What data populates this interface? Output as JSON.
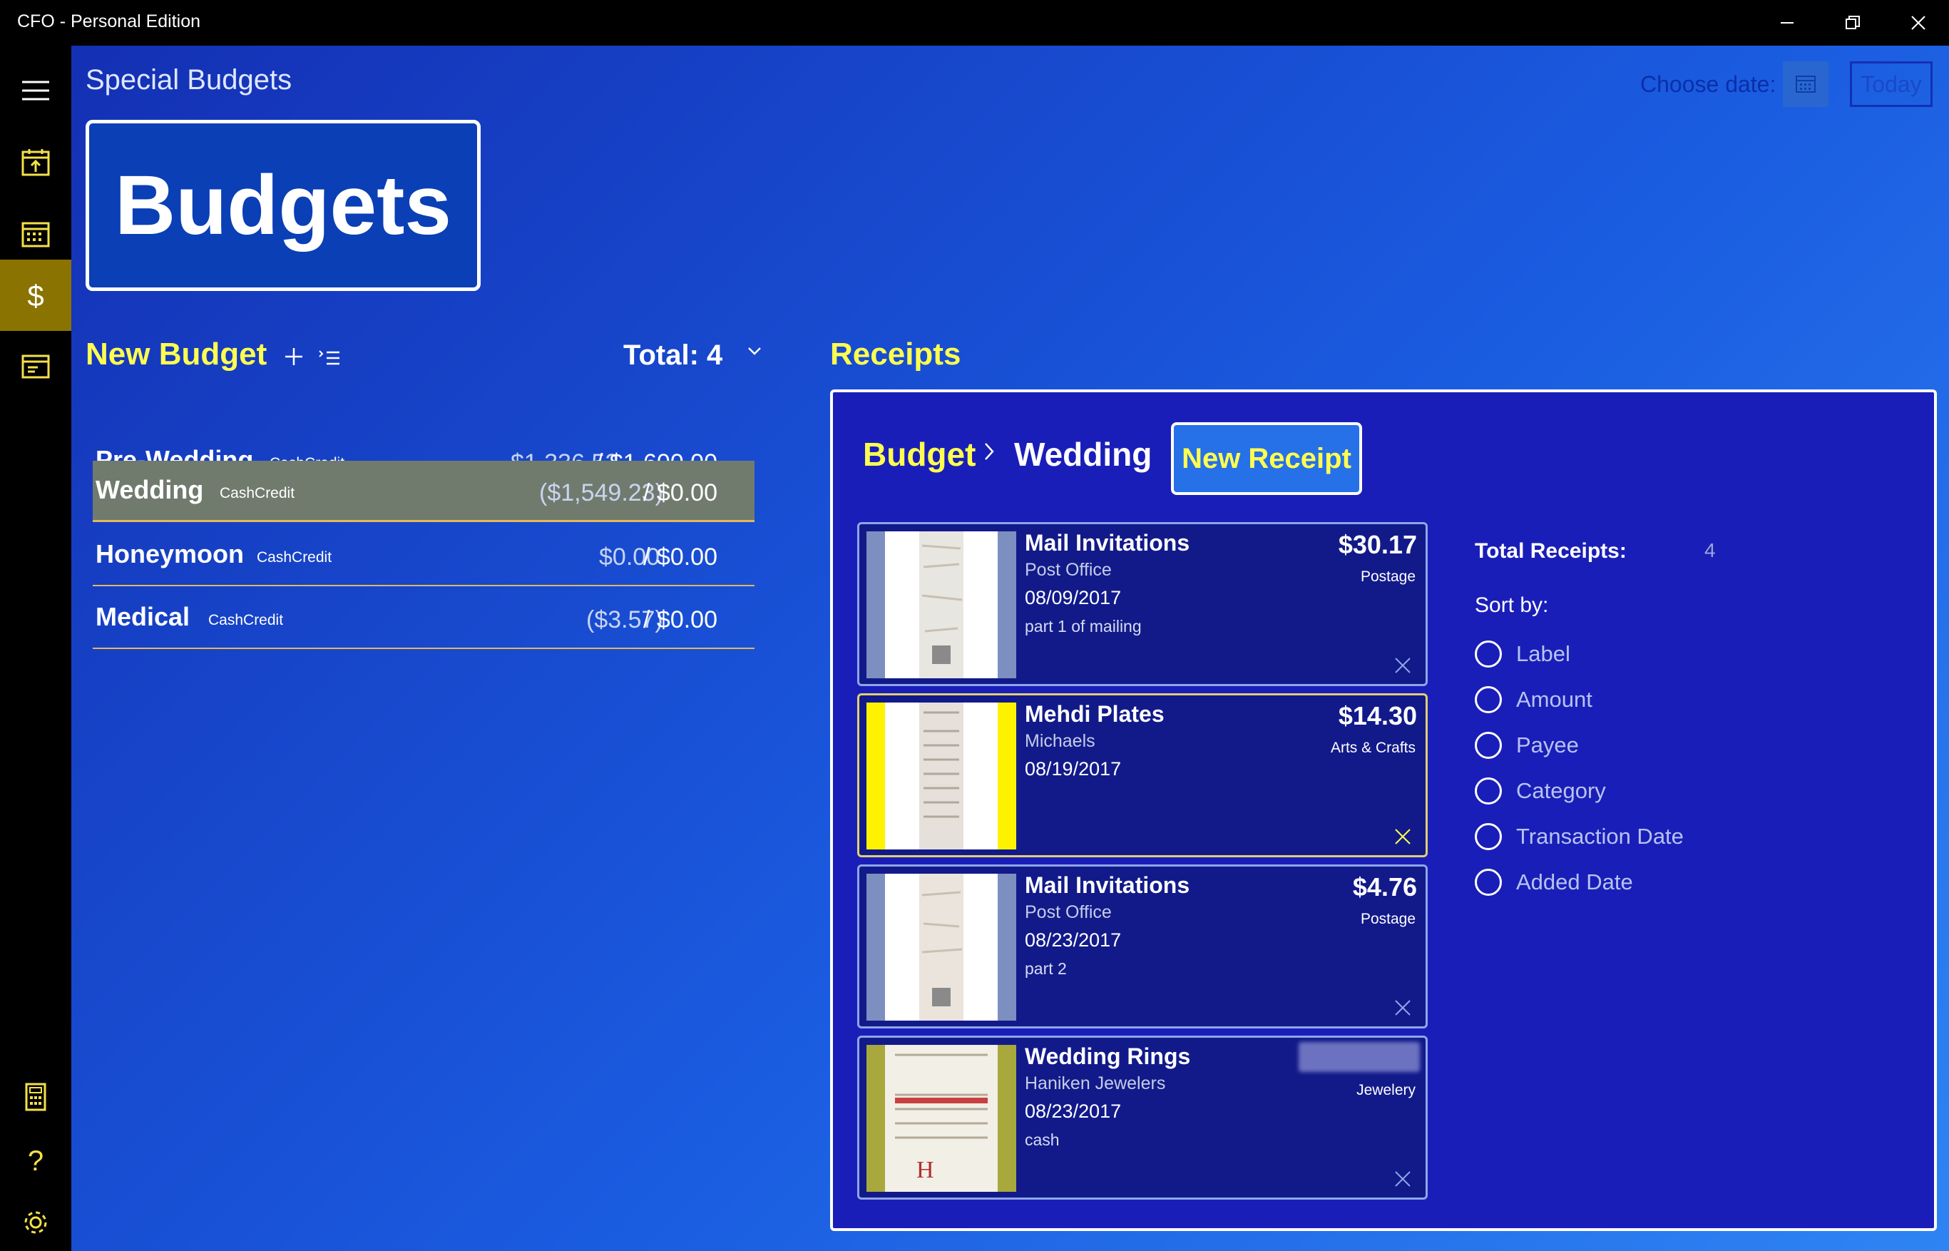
{
  "window": {
    "title": "CFO - Personal Edition"
  },
  "sidebar": {
    "items": [
      {
        "icon": "menu-icon"
      },
      {
        "icon": "calendar-upload-icon"
      },
      {
        "icon": "calendar-icon"
      },
      {
        "icon": "dollar-icon",
        "active": true
      },
      {
        "icon": "archive-icon"
      },
      {
        "icon": "calculator-icon"
      },
      {
        "icon": "help-icon"
      },
      {
        "icon": "gear-icon"
      }
    ]
  },
  "header": {
    "page_title": "Special Budgets",
    "choose_date_label": "Choose date:",
    "today_label": "Today",
    "logo_text": "Budgets"
  },
  "budgets": {
    "new_budget_label": "New Budget",
    "total_label": "Total: 4",
    "items": [
      {
        "name": "Pre-Wedding",
        "type": "CashCredit",
        "spent": "$1,336.52",
        "amount": "/ $1,600.00",
        "selected": false
      },
      {
        "name": "Wedding",
        "type": "CashCredit",
        "spent": "($1,549.23)",
        "amount": "/ $0.00",
        "selected": true
      },
      {
        "name": "Honeymoon",
        "type": "CashCredit",
        "spent": "$0.00",
        "amount": "/ $0.00",
        "selected": false
      },
      {
        "name": "Medical",
        "type": "CashCredit",
        "spent": "($3.57)",
        "amount": "/ $0.00",
        "selected": false
      }
    ]
  },
  "receipts": {
    "heading": "Receipts",
    "breadcrumb_root": "Budget",
    "breadcrumb_current": "Wedding",
    "new_receipt_label": "New Receipt",
    "total_receipts_label": "Total Receipts:",
    "total_receipts_value": "4",
    "sort_by_label": "Sort by:",
    "sort_options": [
      "Label",
      "Amount",
      "Payee",
      "Category",
      "Transaction Date",
      "Added Date"
    ],
    "items": [
      {
        "label": "Mail Invitations",
        "payee": "Post Office",
        "date": "08/09/2017",
        "note": "part 1 of mailing",
        "amount": "$30.17",
        "category": "Postage"
      },
      {
        "label": "Mehdi Plates",
        "payee": "Michaels",
        "date": "08/19/2017",
        "note": "",
        "amount": "$14.30",
        "category": "Arts & Crafts"
      },
      {
        "label": "Mail Invitations",
        "payee": "Post Office",
        "date": "08/23/2017",
        "note": "part 2",
        "amount": "$4.76",
        "category": "Postage"
      },
      {
        "label": "Wedding Rings",
        "payee": "Haniken Jewelers",
        "date": "08/23/2017",
        "note": "cash",
        "amount": "",
        "category": "Jewelery"
      }
    ]
  },
  "colors": {
    "accent_yellow": "#ffff4f",
    "sidebar_active": "#8a7300",
    "selected_row": "#707b6e",
    "panel_bg": "#1a1eb8"
  }
}
